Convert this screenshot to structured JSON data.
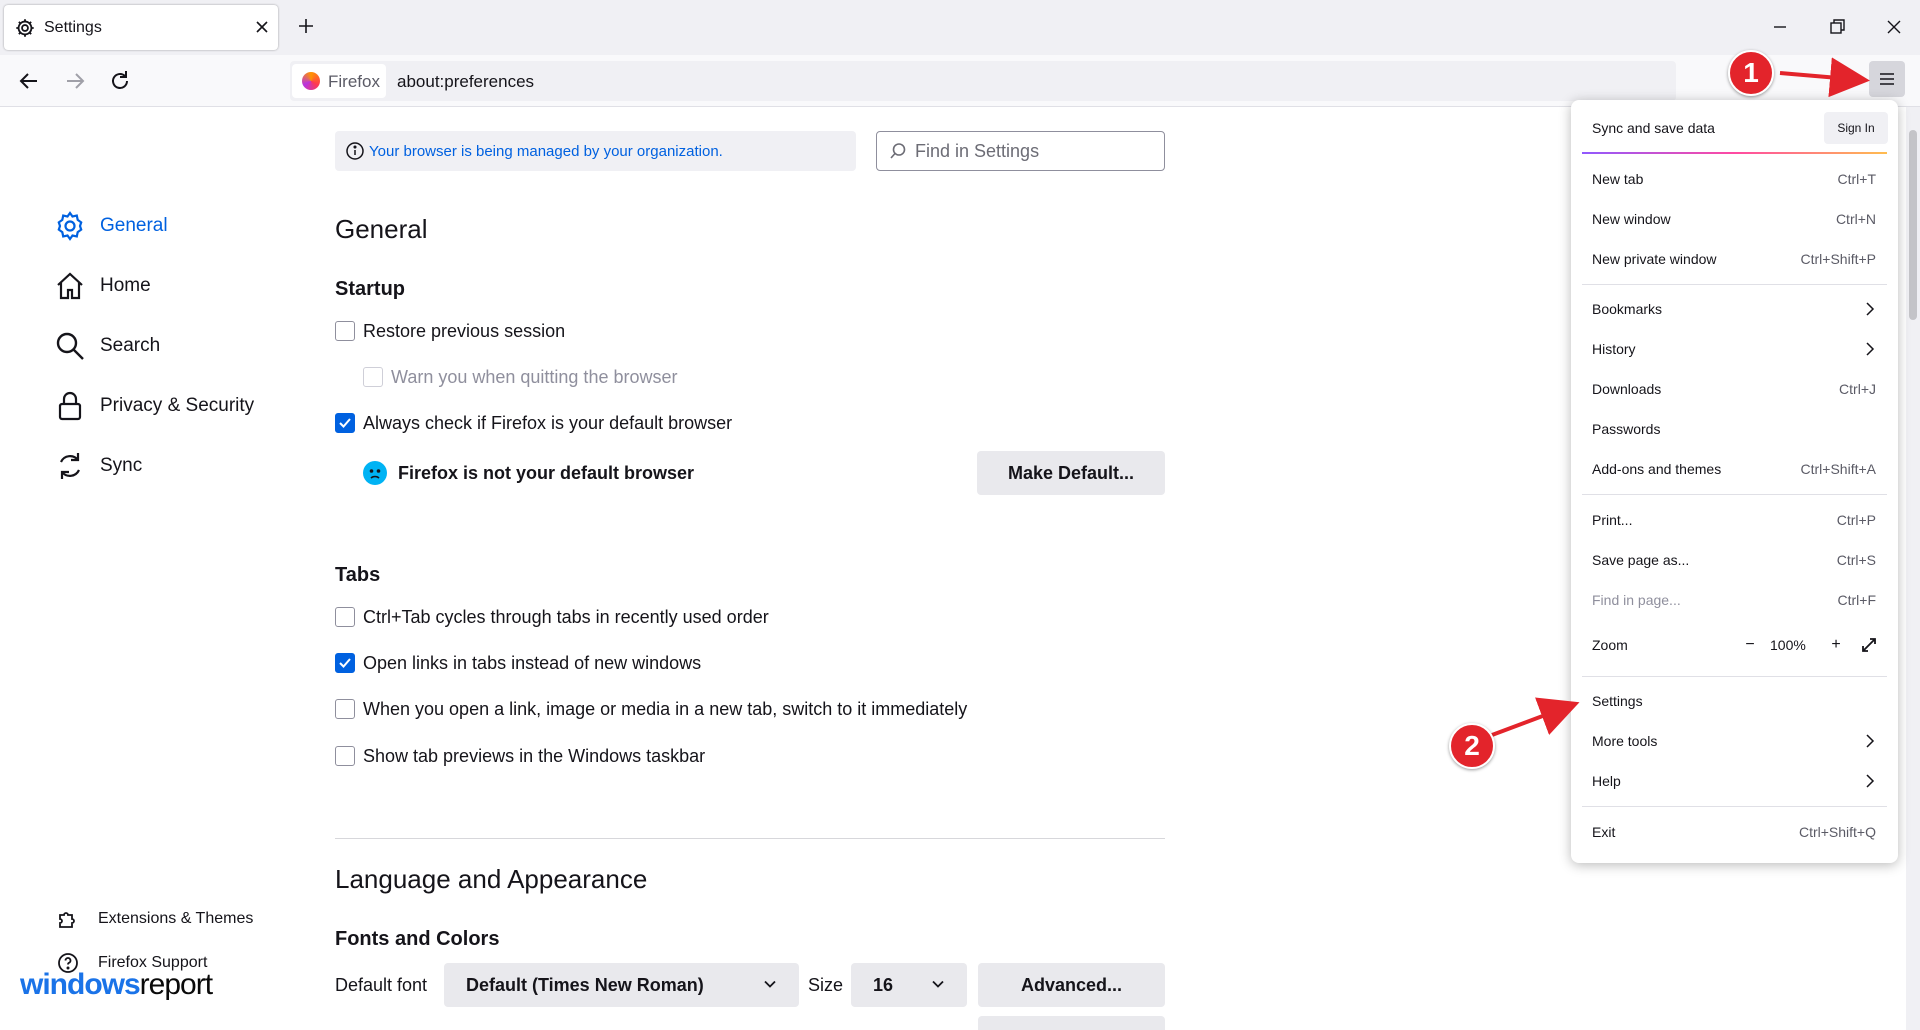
{
  "window": {
    "tab_title": "Settings",
    "new_tab": "+"
  },
  "navbar": {
    "identity": "Firefox",
    "url": "about:preferences"
  },
  "sidebar": {
    "items": [
      {
        "label": "General",
        "icon": "gear-icon",
        "selected": true
      },
      {
        "label": "Home",
        "icon": "home-icon"
      },
      {
        "label": "Search",
        "icon": "search-icon"
      },
      {
        "label": "Privacy & Security",
        "icon": "lock-icon"
      },
      {
        "label": "Sync",
        "icon": "sync-icon"
      }
    ],
    "footer": [
      {
        "label": "Extensions & Themes",
        "icon": "puzzle-icon"
      },
      {
        "label": "Firefox Support",
        "icon": "help-icon"
      }
    ]
  },
  "content": {
    "managed_notice": "Your browser is being managed by your organization.",
    "find_placeholder": "Find in Settings",
    "general_title": "General",
    "startup": {
      "title": "Startup",
      "restore": "Restore previous session",
      "warn": "Warn you when quitting the browser",
      "always_check": "Always check if Firefox is your default browser",
      "not_default": "Firefox is not your default browser",
      "make_default": "Make Default..."
    },
    "tabs": {
      "title": "Tabs",
      "ctrl_tab": "Ctrl+Tab cycles through tabs in recently used order",
      "open_links": "Open links in tabs instead of new windows",
      "switch": "When you open a link, image or media in a new tab, switch to it immediately",
      "previews": "Show tab previews in the Windows taskbar"
    },
    "language": {
      "title": "Language and Appearance",
      "fonts_title": "Fonts and Colors",
      "default_font_label": "Default font",
      "default_font_value": "Default (Times New Roman)",
      "size_label": "Size",
      "size_value": "16",
      "advanced": "Advanced..."
    }
  },
  "menu": {
    "sync_label": "Sync and save data",
    "sign_in": "Sign In",
    "items": {
      "new_tab": {
        "label": "New tab",
        "shortcut": "Ctrl+T"
      },
      "new_window": {
        "label": "New window",
        "shortcut": "Ctrl+N"
      },
      "new_private": {
        "label": "New private window",
        "shortcut": "Ctrl+Shift+P"
      },
      "bookmarks": {
        "label": "Bookmarks"
      },
      "history": {
        "label": "History"
      },
      "downloads": {
        "label": "Downloads",
        "shortcut": "Ctrl+J"
      },
      "passwords": {
        "label": "Passwords"
      },
      "addons": {
        "label": "Add-ons and themes",
        "shortcut": "Ctrl+Shift+A"
      },
      "print": {
        "label": "Print...",
        "shortcut": "Ctrl+P"
      },
      "save_page": {
        "label": "Save page as...",
        "shortcut": "Ctrl+S"
      },
      "find_page": {
        "label": "Find in page...",
        "shortcut": "Ctrl+F"
      },
      "zoom": {
        "label": "Zoom",
        "value": "100%",
        "minus": "−",
        "plus": "+"
      },
      "settings": {
        "label": "Settings"
      },
      "more_tools": {
        "label": "More tools"
      },
      "help": {
        "label": "Help"
      },
      "exit": {
        "label": "Exit",
        "shortcut": "Ctrl+Shift+Q"
      }
    }
  },
  "annotations": {
    "badge1": "1",
    "badge2": "2",
    "color": "#e3242b"
  },
  "watermark": {
    "part1": "windows",
    "part2": "report"
  },
  "colors": {
    "accent": "#0061e0"
  }
}
